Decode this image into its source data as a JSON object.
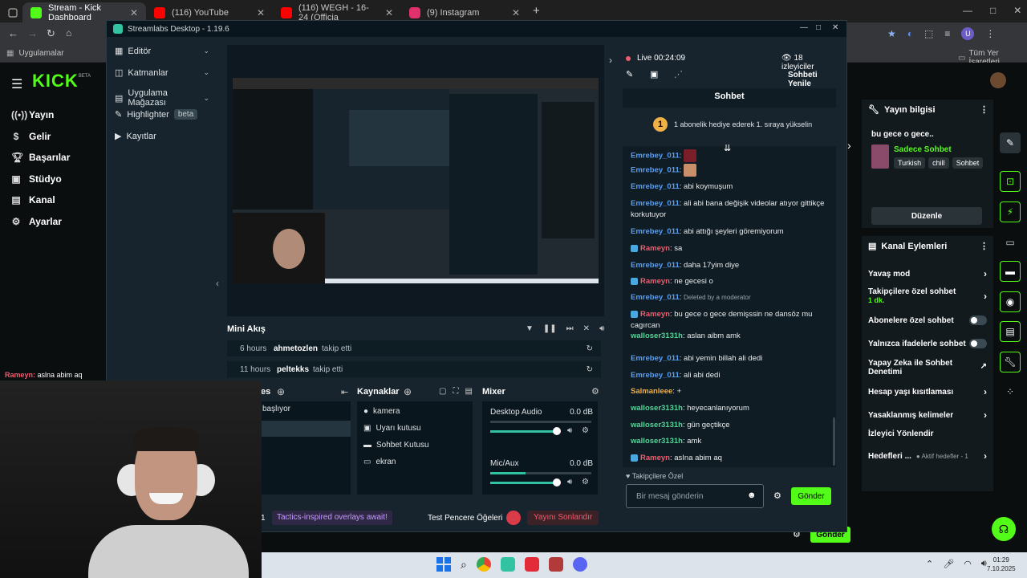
{
  "browser": {
    "tabs": [
      {
        "title": "Stream - Kick Dashboard",
        "color": "#53fc18"
      },
      {
        "title": "(116) YouTube",
        "color": "#ff0000"
      },
      {
        "title": "(116) WEGH - 16-24 (Officia",
        "color": "#ff0000"
      },
      {
        "title": "(9) Instagram",
        "color": "#e1306c"
      }
    ],
    "bookmarks_left": "Uygulamalar",
    "bookmarks_right": "Tüm Yer İşaretleri"
  },
  "kick": {
    "logo": "KICK",
    "logo_badge": "BETA",
    "nav": [
      "Yayın",
      "Gelir",
      "Başarılar",
      "Stüdyo",
      "Kanal",
      "Ayarlar"
    ],
    "overlay_chat": {
      "user": "Rameyn:",
      "text": "aslna abim aq"
    },
    "stream_info": {
      "title": "Yayın bilgisi",
      "stream_title": "bu gece o gece..",
      "category": "Sadece Sohbet",
      "tags": [
        "Turkish",
        "chill",
        "Sohbet"
      ],
      "edit_button": "Düzenle"
    },
    "channel_actions": {
      "title": "Kanal Eylemleri",
      "items": [
        {
          "label": "Yavaş mod",
          "kind": "arrow"
        },
        {
          "label": "Takipçilere özel sohbet",
          "sub": "1 dk.",
          "kind": "arrow"
        },
        {
          "label": "Abonelere özel sohbet",
          "kind": "toggle"
        },
        {
          "label": "Yalnızca ifadelerle sohbet",
          "kind": "toggle"
        },
        {
          "label": "Yapay Zeka ile Sohbet Denetimi",
          "kind": "link"
        },
        {
          "label": "Hesap yaşı kısıtlaması",
          "kind": "arrow"
        },
        {
          "label": "Yasaklanmış kelimeler",
          "kind": "arrow"
        },
        {
          "label": "İzleyici Yönlendir",
          "kind": "none"
        },
        {
          "label": "Hedefleri ...",
          "sub": "Aktif hedefler - 1",
          "kind": "arrow"
        }
      ]
    },
    "bottom_send": "Gönder"
  },
  "streamlabs": {
    "title": "Streamlabs Desktop - 1.19.6",
    "side": [
      {
        "label": "Editör",
        "chev": true
      },
      {
        "label": "Katmanlar",
        "chev": true
      },
      {
        "label": "Uygulama Mağazası",
        "chev": true
      },
      {
        "label": "Highlighter",
        "badge": "beta"
      },
      {
        "label": "Kayıtlar"
      }
    ],
    "mini_feed": {
      "title": "Mini Akış",
      "rows": [
        {
          "time": "6 hours",
          "user": "ahmetozlen",
          "action": "takip etti"
        },
        {
          "time": "11 hours",
          "user": "peltekks",
          "action": "takip etti"
        }
      ]
    },
    "scenes": {
      "title": "es",
      "items": [
        "başlıyor",
        ""
      ]
    },
    "sources": {
      "title": "Kaynaklar",
      "items": [
        "kamera",
        "Uyarı kutusu",
        "Sohbet Kutusu",
        "ekran"
      ]
    },
    "mixer": {
      "title": "Mixer",
      "channels": [
        {
          "name": "Desktop Audio",
          "db": "0.0 dB",
          "level": 0.0
        },
        {
          "name": "Mic/Aux",
          "db": "0.0 dB",
          "level": 0.35
        }
      ]
    },
    "footer": {
      "num": "1",
      "promo": "Tactics-inspired overlays await!",
      "test": "Test Pencere Öğeleri",
      "end": "Yayını Sonlandır"
    },
    "chat_header": {
      "live": "Live",
      "time": "00:24:09",
      "viewers": "18 izleyiciler",
      "refresh": "Sohbeti Yenile",
      "title": "Sohbet"
    },
    "gift_banner": {
      "rank": "1",
      "text": "1 abonelik hediye ederek 1. sıraya yükselin"
    },
    "messages": [
      {
        "user": "Emrebey_011",
        "cls": "u-blue",
        "text": "",
        "emote": "sit"
      },
      {
        "user": "Emrebey_011",
        "cls": "u-blue",
        "text": "",
        "emote": "face"
      },
      {
        "user": "Emrebey_011",
        "cls": "u-blue",
        "text": "abi koymuşum"
      },
      {
        "user": "Emrebey_011",
        "cls": "u-blue",
        "text": "ali abi bana değişik videolar atıyor gittikçe korkutuyor"
      },
      {
        "user": "Emrebey_011",
        "cls": "u-blue",
        "text": "abi attığı şeyleri göremiyorum"
      },
      {
        "user": "Rameyn",
        "cls": "u-red",
        "mod": true,
        "text": "sa"
      },
      {
        "user": "Emrebey_011",
        "cls": "u-blue",
        "text": "daha 17yim diye"
      },
      {
        "user": "Rameyn",
        "cls": "u-red",
        "mod": true,
        "text": "ne gecesi o"
      },
      {
        "user": "Emrebey_011",
        "cls": "u-blue",
        "text": "Deleted by a moderator",
        "deleted": true
      },
      {
        "user": "Rameyn",
        "cls": "u-red",
        "mod": true,
        "text": "bu gece o gece demişssin ne dansöz mu cagırcan"
      },
      {
        "user": "walloser3131h",
        "cls": "u-green",
        "text": "aslan aibm amk"
      },
      {
        "user": "Emrebey_011",
        "cls": "u-blue",
        "text": "abi yemin billah ali dedi"
      },
      {
        "user": "Emrebey_011",
        "cls": "u-blue",
        "text": "ali abi dedi"
      },
      {
        "user": "Salmanleee",
        "cls": "u-orange",
        "text": "+"
      },
      {
        "user": "walloser3131h",
        "cls": "u-green",
        "text": "heyecanlanıyorum"
      },
      {
        "user": "walloser3131h",
        "cls": "u-green",
        "text": "gün geçtikçe"
      },
      {
        "user": "walloser3131h",
        "cls": "u-green",
        "text": "amk"
      },
      {
        "user": "Rameyn",
        "cls": "u-red",
        "mod": true,
        "text": "asIna abim aq"
      }
    ],
    "chat_mode": "Takipçilere Özel",
    "chat_placeholder": "Bir mesaj gönderin",
    "send": "Gönder"
  },
  "taskbar": {
    "time": "01:29",
    "date": "7.10.2025"
  },
  "colors": {
    "kick_green": "#53fc18",
    "sl_bg": "#17242d",
    "sl_accent": "#31c3a2",
    "end_red": "#d93c48"
  }
}
